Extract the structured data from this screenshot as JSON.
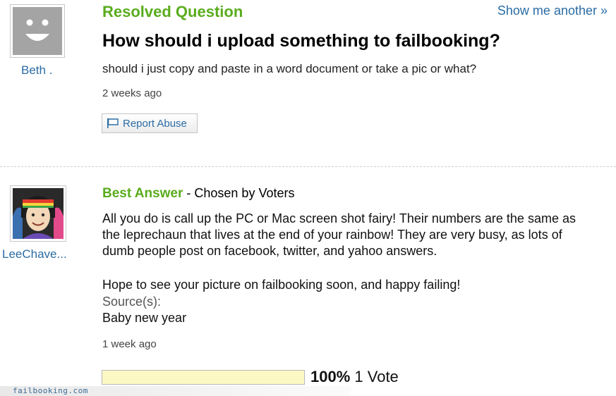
{
  "header": {
    "status": "Resolved Question",
    "show_another": "Show me another »"
  },
  "question": {
    "asker": "Beth .",
    "title": "How should i upload something to failbooking?",
    "body": "should i just copy and paste in a word document or take a pic or what?",
    "time": "2 weeks ago",
    "report_label": "Report Abuse",
    "avatar_icon": "default-smiley-avatar-icon"
  },
  "best_answer": {
    "answerer": "LeeChave...",
    "label": "Best Answer",
    "chosen_by": " - Chosen by Voters",
    "lines": [
      "All you do is call up the PC or Mac screen shot fairy! Their numbers are the same as",
      "the leprechaun that lives at the end of your rainbow! They are very busy, as lots of",
      "dumb people post on facebook, twitter, and yahoo answers.",
      "Hope to see your picture on failbooking soon, and happy failing!"
    ],
    "source_label": "Source(s):",
    "source_value": "Baby new year",
    "time": "1 week ago",
    "vote_percent": "100%",
    "vote_fraction": 1.0,
    "vote_count": "1 Vote"
  },
  "watermark": "failbooking.com",
  "colors": {
    "green": "#5aac1d",
    "link_blue": "#2b6ca4",
    "vote_fill": "#fbf8c4"
  }
}
